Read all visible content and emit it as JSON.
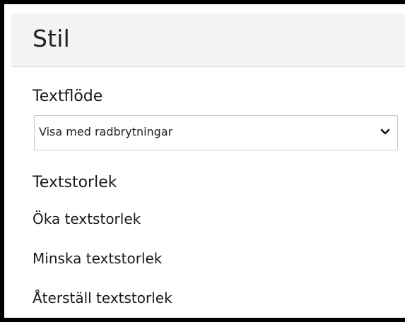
{
  "panel": {
    "title": "Stil"
  },
  "text_flow": {
    "label": "Textflöde",
    "select": {
      "selected": "Visa med radbrytningar",
      "chevron_icon": "chevron-down-icon"
    }
  },
  "text_size": {
    "label": "Textstorlek",
    "actions": [
      {
        "label": "Öka textstorlek"
      },
      {
        "label": "Minska textstorlek"
      },
      {
        "label": "Återställ textstorlek"
      }
    ]
  }
}
